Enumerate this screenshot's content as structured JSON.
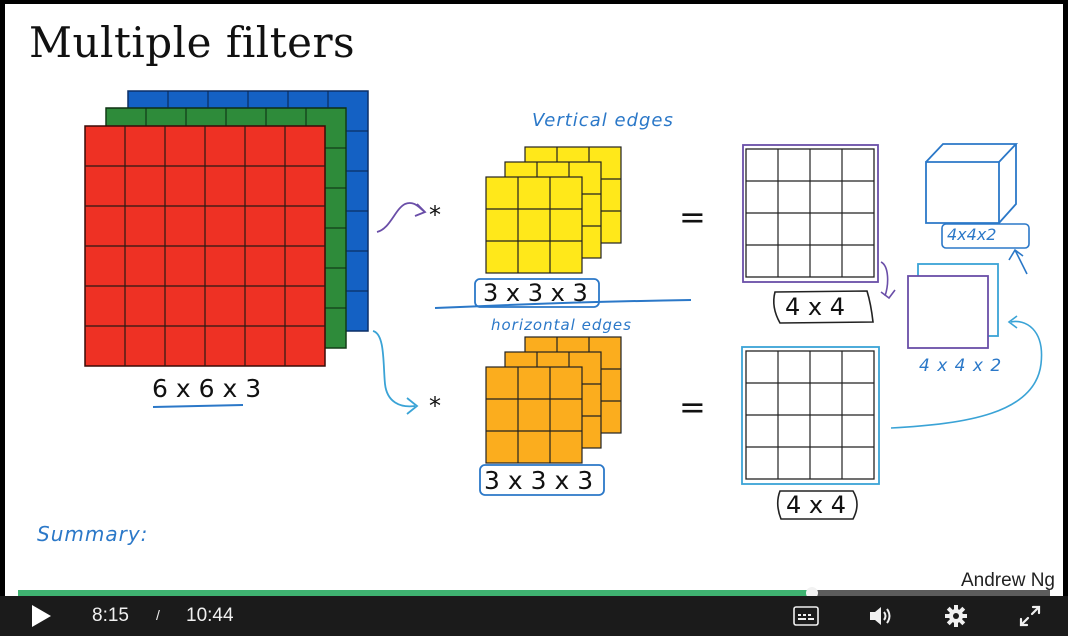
{
  "slide": {
    "title": "Multiple filters",
    "credit": "Andrew Ng",
    "input_label": "6 x 6 x 3",
    "filter1_label": "3 x 3 x 3",
    "filter2_label": "3 x 3 x 3",
    "output1_label": "4 x 4",
    "output2_label": "4 x 4",
    "operator_conv": "*",
    "operator_eq": "=",
    "hand_vertical": "Vertical edges",
    "hand_horizontal": "horizontal edges",
    "hand_stack_small": "4 x 4 x 2",
    "hand_stack_top": "4x4x2",
    "hand_summary": "Summary:",
    "colors": {
      "red": "#ee3124",
      "green": "#2e8b3a",
      "blue": "#1461c4",
      "yellow": "#ffe81a",
      "orange": "#fbad1e",
      "pen_blue": "#2b78c8",
      "pen_purple": "#6a4ea8",
      "pen_cyan": "#3aa3d6"
    }
  },
  "player": {
    "current_time": "8:15",
    "separator": "/",
    "duration": "10:44",
    "progress": 0.769,
    "icons": {
      "play": "play-icon",
      "captions": "captions-icon",
      "volume": "volume-icon",
      "settings": "gear-icon",
      "fullscreen": "fullscreen-icon"
    }
  }
}
